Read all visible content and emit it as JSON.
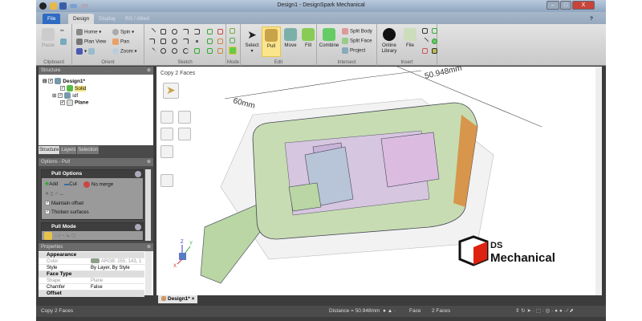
{
  "window": {
    "title": "Design1 - DesignSpark Mechanical",
    "minimize": "–",
    "maximize": "□",
    "close": "X",
    "help": "?"
  },
  "tabs": [
    "File",
    "Design",
    "Display",
    "RS / Allied"
  ],
  "ribbon": {
    "clipboard": {
      "label": "Clipboard",
      "paste": "Paste"
    },
    "orient": {
      "label": "Orient",
      "home": "Home",
      "spin": "Spin",
      "plan_view": "Plan View",
      "pan": "Pan",
      "zoom": "Zoom"
    },
    "sketch": {
      "label": "Sketch"
    },
    "mode": {
      "label": "Mode"
    },
    "edit": {
      "label": "Edit",
      "select": "Select",
      "pull": "Pull",
      "move": "Move",
      "fill": "Fill"
    },
    "intersect": {
      "label": "Intersect",
      "combine": "Combine",
      "split_body": "Split Body",
      "split_face": "Split Face",
      "project": "Project"
    },
    "insert": {
      "label": "Insert",
      "online_library": "Online Library",
      "file": "File"
    }
  },
  "structure": {
    "title": "Structure",
    "items": [
      {
        "label": "Design1*"
      },
      {
        "label": "Solid"
      },
      {
        "label": "idf"
      },
      {
        "label": "Plane"
      }
    ],
    "tabs": [
      "Structure",
      "Layers",
      "Selection"
    ]
  },
  "options": {
    "title": "Options - Pull",
    "pull_options": "Pull Options",
    "add": "Add",
    "cut": "Cut",
    "no_merge": "No merge",
    "maintain_offset": "Maintain offset",
    "thicken_surfaces": "Thicken surfaces",
    "pull_mode": "Pull Mode"
  },
  "properties": {
    "title": "Properties",
    "rows": [
      {
        "type": "cat",
        "key": "Appearance"
      },
      {
        "key": "Color",
        "value": "ARGB: 255, 143, 1",
        "dim": true
      },
      {
        "key": "Style",
        "value": "By Layer, By Style"
      },
      {
        "type": "cat",
        "key": "Face Type"
      },
      {
        "key": "Shape",
        "value": "Plane",
        "dim": true
      },
      {
        "key": "Chamfer",
        "value": "False"
      },
      {
        "type": "cat",
        "key": "Offset"
      }
    ]
  },
  "viewport": {
    "heading": "Copy 2 Faces",
    "dim1": "60mm",
    "dim2": "50.948mm",
    "logo_text": "DS Mechanical"
  },
  "doc_tab": {
    "label": "Design1*",
    "close": "×"
  },
  "status": {
    "message": "Copy 2 Faces",
    "distance": "Distance = 50.948mm",
    "filter": "Face",
    "selection": "2 Faces"
  },
  "colors": {
    "accent": "#2f6bc2",
    "pull_highlight": "#fbe58a",
    "body_purple": "#c9b4d8",
    "body_green": "#b9d6a4",
    "shell_orange": "#d98a3a"
  }
}
